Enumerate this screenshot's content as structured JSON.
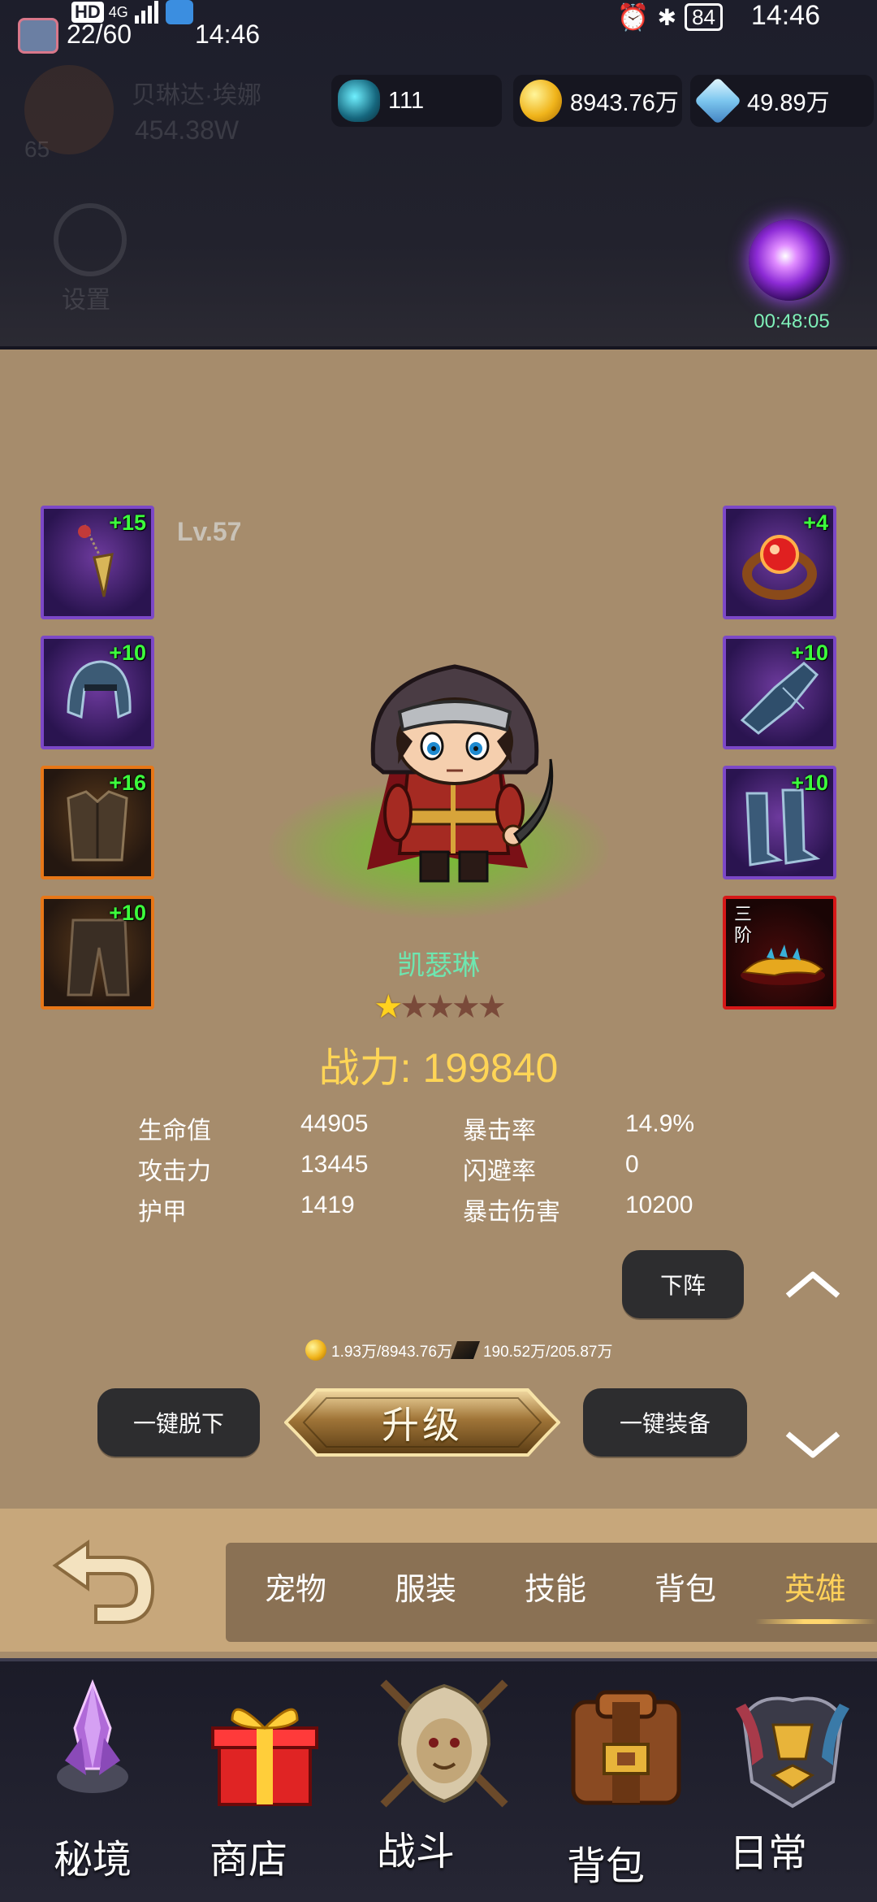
{
  "status_bar": {
    "left_badge": "HD",
    "signal": "4G",
    "time": "14:46",
    "battery": "84"
  },
  "game_header": {
    "energy": "22/60",
    "clock": "14:46",
    "ghost_player_name": "贝琳达·埃娜",
    "ghost_power": "454.38W",
    "ghost_level": "65",
    "ghost_settings": "设置",
    "resources": {
      "rune": "111",
      "gold": "8943.76万",
      "gems": "49.89万"
    },
    "orb_timer": "00:48:05"
  },
  "hero": {
    "level": "Lv.57",
    "name": "凯瑟琳",
    "stars_filled": 1,
    "stars_total": 5,
    "power_label": "战力: 199840"
  },
  "equipment": {
    "left": [
      {
        "name": "amulet",
        "level": "+15",
        "rarity": "purple"
      },
      {
        "name": "helmet",
        "level": "+10",
        "rarity": "purple"
      },
      {
        "name": "armor",
        "level": "+16",
        "rarity": "orange"
      },
      {
        "name": "pants",
        "level": "+10",
        "rarity": "orange"
      }
    ],
    "right": [
      {
        "name": "ring",
        "level": "+4",
        "rarity": "purple"
      },
      {
        "name": "gauntlets",
        "level": "+10",
        "rarity": "purple"
      },
      {
        "name": "boots",
        "level": "+10",
        "rarity": "purple"
      },
      {
        "name": "pet",
        "tier": "三阶",
        "rarity": "red"
      }
    ]
  },
  "stats": [
    {
      "label": "生命值",
      "value": "44905"
    },
    {
      "label": "攻击力",
      "value": "13445"
    },
    {
      "label": "护甲",
      "value": "1419"
    },
    {
      "label": "暴击率",
      "value": "14.9%"
    },
    {
      "label": "闪避率",
      "value": "0"
    },
    {
      "label": "暴击伤害",
      "value": "10200"
    }
  ],
  "buttons": {
    "withdraw": "下阵",
    "unequip_all": "一键脱下",
    "upgrade": "升级",
    "equip_all": "一键装备"
  },
  "cost": {
    "gold": "1.93万/8943.76万",
    "scroll": "190.52万/205.87万"
  },
  "tabs": [
    {
      "label": "宠物"
    },
    {
      "label": "服装"
    },
    {
      "label": "技能"
    },
    {
      "label": "背包"
    },
    {
      "label": "英雄",
      "active": true
    }
  ],
  "bottom_nav": [
    {
      "label": "秘境",
      "icon": "crystal-realm-icon"
    },
    {
      "label": "商店",
      "icon": "gift-box-icon"
    },
    {
      "label": "战斗",
      "icon": "lion-crest-icon"
    },
    {
      "label": "背包",
      "icon": "backpack-icon"
    },
    {
      "label": "日常",
      "icon": "daily-emblem-icon"
    }
  ],
  "colors": {
    "background": "#a68c6c",
    "header": "#1d1e2b",
    "power": "#ffd556",
    "hero_name": "#6ee6b0",
    "active_tab": "#ffd15a",
    "equip_level": "#3cff3c"
  }
}
